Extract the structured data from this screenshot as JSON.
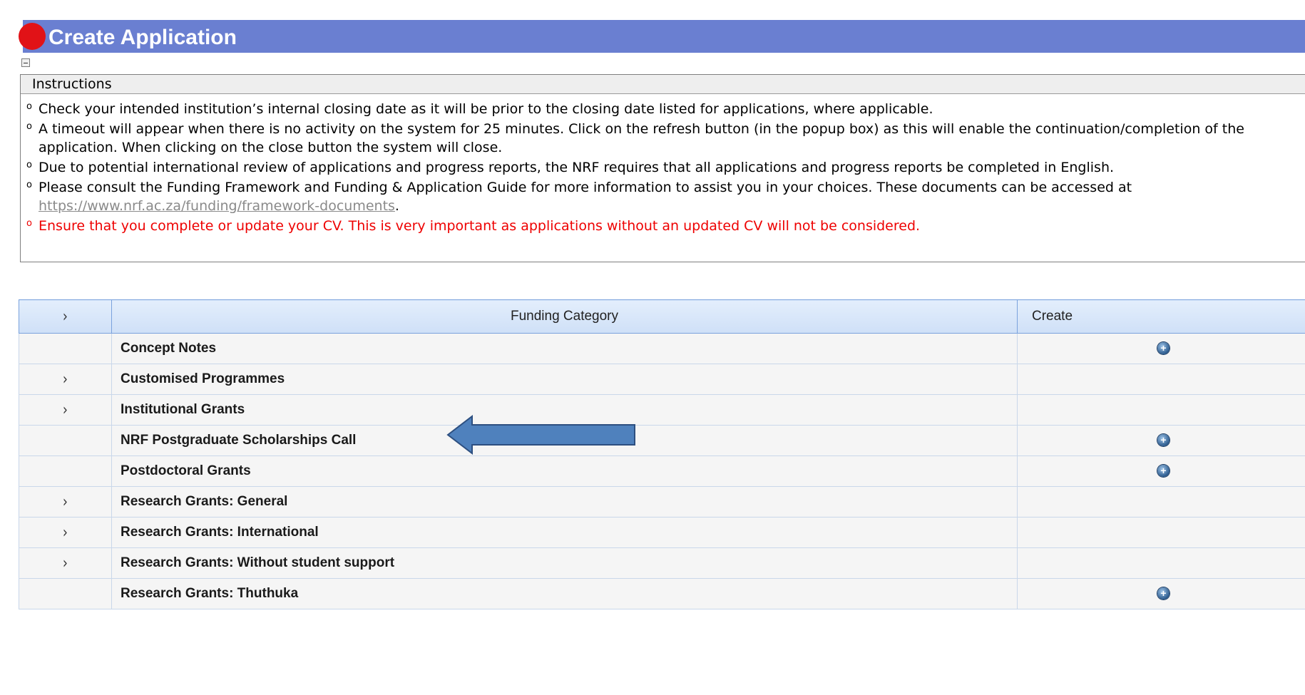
{
  "header": {
    "title": "Create Application"
  },
  "instructions": {
    "heading": "Instructions",
    "items": [
      {
        "text": "Check your intended institution’s internal closing date as it will be prior to the closing date listed for applications, where applicable."
      },
      {
        "text": "A timeout will appear when there is no activity on the system for 25 minutes. Click on the refresh button (in the popup box) as this will enable the continuation/completion of the application. When clicking on the close button the system will close."
      },
      {
        "text": "Due to potential international review of applications and progress reports, the NRF requires that all applications and progress reports be completed in English."
      },
      {
        "text_before": "Please consult the Funding Framework and Funding & Application Guide for more information to assist you in your choices. These documents can be accessed at ",
        "link": "https://www.nrf.ac.za/funding/framework-documents",
        "text_after": "."
      },
      {
        "text": "Ensure that you complete or update your CV. This is very important as applications without an updated CV will not be considered.",
        "color": "#ee0000"
      }
    ]
  },
  "table": {
    "columns": {
      "expand": "›",
      "category": "Funding Category",
      "create": "Create"
    },
    "rows": [
      {
        "label": "Concept Notes",
        "expandable": false,
        "create": true
      },
      {
        "label": "Customised Programmes",
        "expandable": true,
        "create": false
      },
      {
        "label": "Institutional Grants",
        "expandable": true,
        "create": false
      },
      {
        "label": "NRF Postgraduate Scholarships Call",
        "expandable": false,
        "create": true
      },
      {
        "label": "Postdoctoral Grants",
        "expandable": false,
        "create": true
      },
      {
        "label": "Research Grants: General",
        "expandable": true,
        "create": false
      },
      {
        "label": "Research Grants: International",
        "expandable": true,
        "create": false
      },
      {
        "label": "Research Grants: Without student support",
        "expandable": true,
        "create": false
      },
      {
        "label": "Research Grants: Thuthuka",
        "expandable": false,
        "create": true
      }
    ]
  },
  "icons": {
    "expand": "chevron-right-icon",
    "create": "add-circle-icon",
    "annotation": "left-arrow-icon"
  },
  "colors": {
    "banner": "#6a7fd1",
    "dot": "#e11217",
    "warning": "#ee0000",
    "arrow": "#4f81bd"
  }
}
